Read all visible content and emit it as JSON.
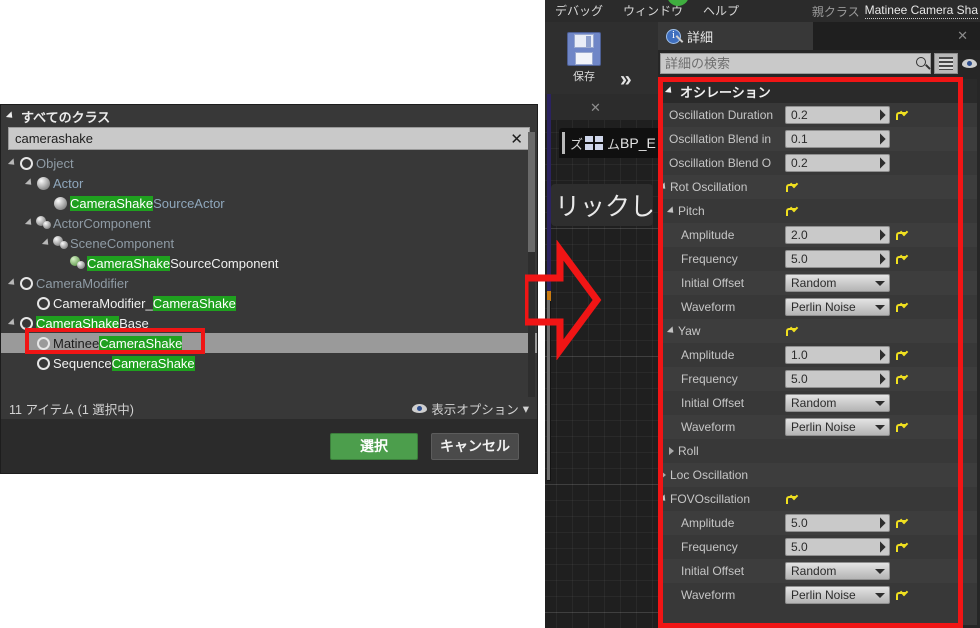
{
  "editor": {
    "menubar": [
      "デバッグ",
      "ウィンドウ",
      "ヘルプ"
    ],
    "parent_class_label": "親クラス",
    "parent_class_value": "Matinee Camera Sha",
    "toolbar": {
      "save_label": "保存"
    },
    "graph": {
      "node_prefix": "ズ",
      "node_suffix": "ム",
      "node_name": "BP_E",
      "tooltip": "リックし"
    },
    "details": {
      "tab_label": "詳細",
      "search_placeholder": "詳細の検索",
      "search_value": "",
      "category": "オシレーション",
      "rows": [
        {
          "name": "Oscillation Duration",
          "indent": 1,
          "type": "number",
          "value": "0.2",
          "reset": true
        },
        {
          "name": "Oscillation Blend in",
          "indent": 1,
          "type": "number",
          "value": "0.1",
          "reset": false
        },
        {
          "name": "Oscillation Blend O",
          "indent": 1,
          "type": "number",
          "value": "0.2",
          "reset": false
        },
        {
          "name": "Rot Oscillation",
          "indent": 0,
          "type": "group",
          "expanded": true,
          "reset": true
        },
        {
          "name": "Pitch",
          "indent": 1,
          "type": "group",
          "expanded": true,
          "reset": true
        },
        {
          "name": "Amplitude",
          "indent": 2,
          "type": "number",
          "value": "2.0",
          "reset": true
        },
        {
          "name": "Frequency",
          "indent": 2,
          "type": "number",
          "value": "5.0",
          "reset": true
        },
        {
          "name": "Initial Offset",
          "indent": 2,
          "type": "combo",
          "value": "Random",
          "reset": false
        },
        {
          "name": "Waveform",
          "indent": 2,
          "type": "combo",
          "value": "Perlin Noise",
          "reset": true
        },
        {
          "name": "Yaw",
          "indent": 1,
          "type": "group",
          "expanded": true,
          "reset": true
        },
        {
          "name": "Amplitude",
          "indent": 2,
          "type": "number",
          "value": "1.0",
          "reset": true
        },
        {
          "name": "Frequency",
          "indent": 2,
          "type": "number",
          "value": "5.0",
          "reset": true
        },
        {
          "name": "Initial Offset",
          "indent": 2,
          "type": "combo",
          "value": "Random",
          "reset": false
        },
        {
          "name": "Waveform",
          "indent": 2,
          "type": "combo",
          "value": "Perlin Noise",
          "reset": true
        },
        {
          "name": "Roll",
          "indent": 1,
          "type": "group",
          "expanded": false,
          "reset": false
        },
        {
          "name": "Loc Oscillation",
          "indent": 0,
          "type": "group",
          "expanded": false,
          "reset": false
        },
        {
          "name": "FOVOscillation",
          "indent": 0,
          "type": "group",
          "expanded": true,
          "reset": true
        },
        {
          "name": "Amplitude",
          "indent": 2,
          "type": "number",
          "value": "5.0",
          "reset": true
        },
        {
          "name": "Frequency",
          "indent": 2,
          "type": "number",
          "value": "5.0",
          "reset": true
        },
        {
          "name": "Initial Offset",
          "indent": 2,
          "type": "combo",
          "value": "Random",
          "reset": false
        },
        {
          "name": "Waveform",
          "indent": 2,
          "type": "combo",
          "value": "Perlin Noise",
          "reset": true
        }
      ]
    }
  },
  "picker": {
    "title": "すべてのクラス",
    "search_value": "camerashake",
    "search_placeholder": "",
    "clear_label": "✕",
    "tree": [
      {
        "label": "Object",
        "plain": "Object",
        "indent": 0,
        "tri": true,
        "icon": "ring",
        "style": "dim"
      },
      {
        "label": "Actor",
        "plain": "Actor",
        "indent": 1,
        "tri": true,
        "icon": "ball",
        "style": "blue"
      },
      {
        "label": "CameraShakeSourceActor",
        "hl": "CameraShake",
        "rest": "SourceActor",
        "indent": 2,
        "tri": false,
        "icon": "ball",
        "style": "blue"
      },
      {
        "label": "ActorComponent",
        "plain": "ActorComponent",
        "indent": 1,
        "tri": true,
        "icon": "comp",
        "style": "dim"
      },
      {
        "label": "SceneComponent",
        "plain": "SceneComponent",
        "indent": 2,
        "tri": true,
        "icon": "comp",
        "style": "dim"
      },
      {
        "label": "CameraShakeSourceComponent",
        "hl": "CameraShake",
        "rest": "SourceComponent",
        "indent": 3,
        "tri": false,
        "icon": "comp",
        "style": "white"
      },
      {
        "label": "CameraModifier",
        "plain": "CameraModifier",
        "indent": 0,
        "tri": true,
        "icon": "ring",
        "style": "dim"
      },
      {
        "label": "CameraModifier_CameraShake",
        "pre": "CameraModifier_",
        "hl": "CameraShake",
        "indent": 1,
        "tri": false,
        "icon": "ring",
        "style": "white"
      },
      {
        "label": "CameraShakeBase",
        "hl": "CameraShake",
        "rest": "Base",
        "indent": 0,
        "tri": true,
        "icon": "ring",
        "style": "white"
      },
      {
        "label": "MatineeCameraShake",
        "pre": "Matinee",
        "hl": "CameraShake",
        "indent": 1,
        "tri": false,
        "icon": "ring",
        "style": "dark",
        "selected": true
      },
      {
        "label": "SequenceCameraShake",
        "pre": "Sequence",
        "hl": "CameraShake",
        "indent": 1,
        "tri": false,
        "icon": "ring",
        "style": "white"
      }
    ],
    "status_left": "11 アイテム (1 選択中)",
    "status_right": "表示オプション",
    "status_caret": "▾",
    "select_button": "選択",
    "cancel_button": "キャンセル"
  },
  "colors": {
    "highlight_green": "#1fa01f",
    "annotation_red": "#f01515",
    "select_button_green": "#4c9e4c",
    "reset_yellow": "#f0e020"
  }
}
